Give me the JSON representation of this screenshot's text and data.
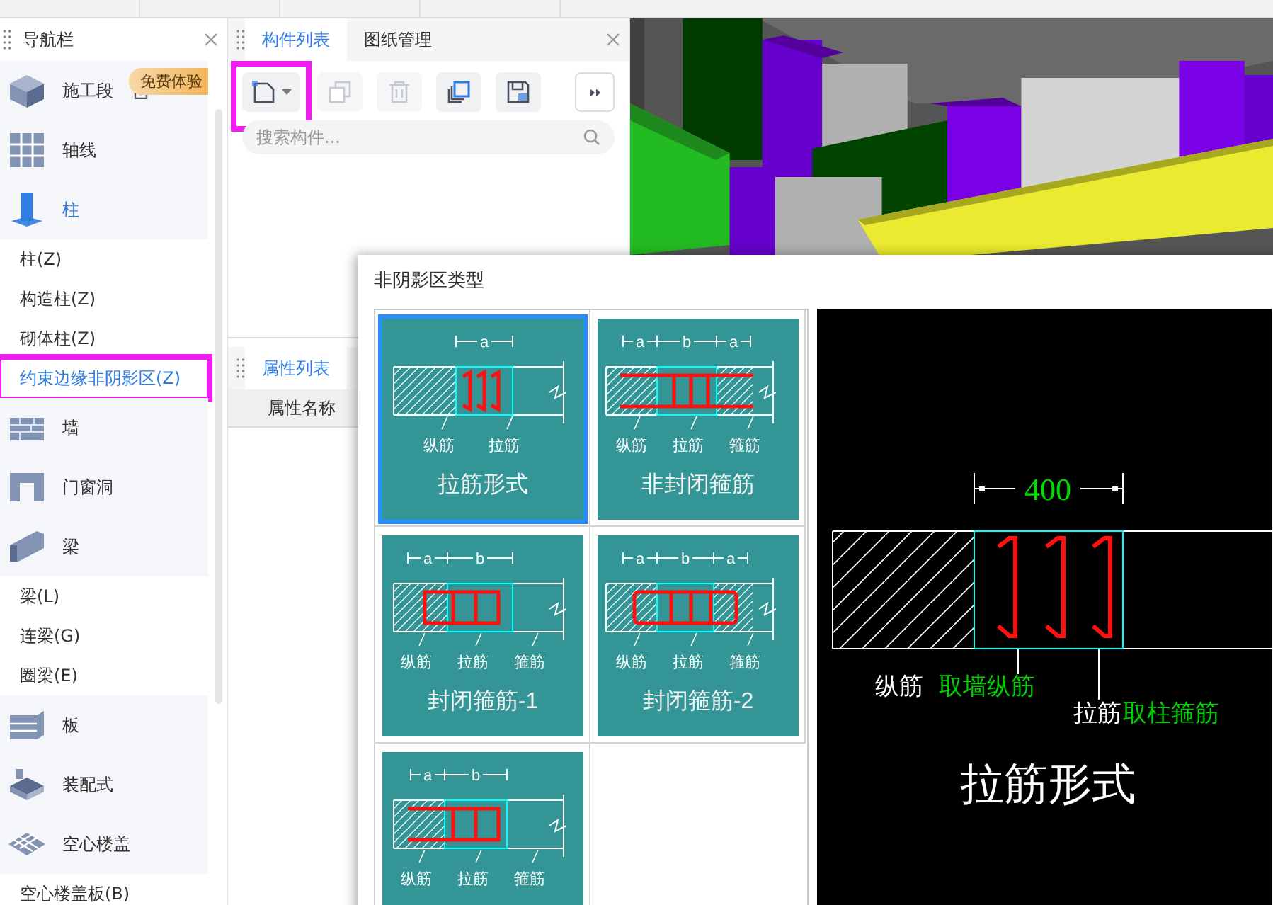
{
  "nav": {
    "title": "导航栏",
    "items": [
      {
        "kind": "category",
        "label": "施工段",
        "selected": false,
        "highlighted": false,
        "locked": true,
        "badge": "免费体验"
      },
      {
        "kind": "category",
        "label": "轴线",
        "selected": false,
        "highlighted": false
      },
      {
        "kind": "category",
        "label": "柱",
        "selected": true,
        "highlighted": false
      },
      {
        "kind": "item",
        "label": "柱(Z)",
        "selected": false,
        "highlighted": false
      },
      {
        "kind": "item",
        "label": "构造柱(Z)",
        "selected": false,
        "highlighted": false
      },
      {
        "kind": "item",
        "label": "砌体柱(Z)",
        "selected": false,
        "highlighted": false
      },
      {
        "kind": "item",
        "label": "约束边缘非阴影区(Z)",
        "selected": true,
        "highlighted": true
      },
      {
        "kind": "category",
        "label": "墙",
        "selected": false,
        "highlighted": false
      },
      {
        "kind": "category",
        "label": "门窗洞",
        "selected": false,
        "highlighted": false
      },
      {
        "kind": "category",
        "label": "梁",
        "selected": false,
        "highlighted": false
      },
      {
        "kind": "item",
        "label": "梁(L)",
        "selected": false,
        "highlighted": false
      },
      {
        "kind": "item",
        "label": "连梁(G)",
        "selected": false,
        "highlighted": false
      },
      {
        "kind": "item",
        "label": "圈梁(E)",
        "selected": false,
        "highlighted": false
      },
      {
        "kind": "category",
        "label": "板",
        "selected": false,
        "highlighted": false
      },
      {
        "kind": "category",
        "label": "装配式",
        "selected": false,
        "highlighted": false
      },
      {
        "kind": "category",
        "label": "空心楼盖",
        "selected": false,
        "highlighted": false
      },
      {
        "kind": "item",
        "label": "空心楼盖板(B)",
        "selected": false,
        "highlighted": false
      }
    ]
  },
  "component_panel": {
    "tabs": [
      {
        "label": "构件列表",
        "selected": true
      },
      {
        "label": "图纸管理",
        "selected": false
      }
    ],
    "toolbar": [
      {
        "kind": "new",
        "disabled": false,
        "highlighted": true
      },
      {
        "kind": "copy",
        "disabled": true,
        "highlighted": false
      },
      {
        "kind": "delete",
        "disabled": true,
        "highlighted": false
      },
      {
        "kind": "copy-floor",
        "disabled": false,
        "highlighted": false
      },
      {
        "kind": "save",
        "disabled": false,
        "highlighted": false
      },
      {
        "kind": "more",
        "disabled": false,
        "highlighted": false
      }
    ],
    "search": {
      "placeholder": "搜索构件..."
    }
  },
  "property_panel": {
    "tabs": [
      {
        "label": "属性列表",
        "selected": true
      }
    ],
    "columns": [
      "属性名称"
    ]
  },
  "dialog": {
    "title": "非阴影区类型",
    "options": [
      {
        "kind": "tie",
        "title": "拉筋形式",
        "selected": true,
        "dims": [
          "a"
        ],
        "labels": [
          "纵筋",
          "拉筋"
        ]
      },
      {
        "kind": "open",
        "title": "非封闭箍筋",
        "selected": false,
        "dims": [
          "a",
          "b",
          "a"
        ],
        "labels": [
          "纵筋",
          "拉筋",
          "箍筋"
        ]
      },
      {
        "kind": "closed1",
        "title": "封闭箍筋-1",
        "selected": false,
        "dims": [
          "a",
          "b"
        ],
        "labels": [
          "纵筋",
          "拉筋",
          "箍筋"
        ]
      },
      {
        "kind": "closed2",
        "title": "封闭箍筋-2",
        "selected": false,
        "dims": [
          "a",
          "b",
          "a"
        ],
        "labels": [
          "纵筋",
          "拉筋",
          "箍筋"
        ]
      },
      {
        "kind": "closed3",
        "selected": false,
        "dims": [
          "a",
          "b"
        ],
        "labels": [
          "纵筋",
          "拉筋",
          "箍筋"
        ]
      }
    ],
    "preview": {
      "dimension": "400",
      "notes": [
        {
          "label": "纵筋",
          "value": "取墙纵筋"
        },
        {
          "label": "拉筋",
          "value": "取柱箍筋"
        }
      ],
      "title": "拉筋形式"
    }
  }
}
